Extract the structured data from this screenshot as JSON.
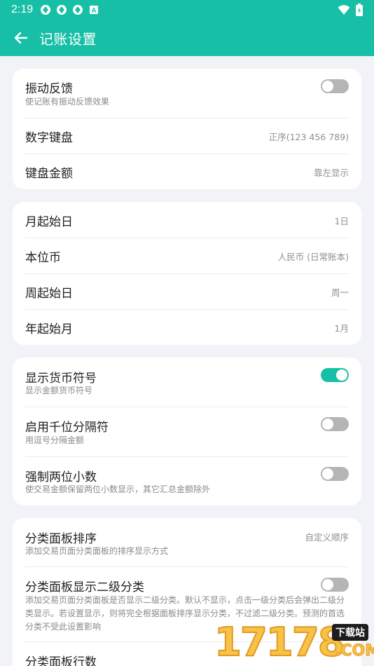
{
  "status_bar": {
    "time": "2:19",
    "icons": [
      "app-notification-icon",
      "app-notification-icon",
      "app-notification-icon",
      "a-badge-icon"
    ],
    "right_icons": [
      "wifi-icon",
      "battery-icon"
    ]
  },
  "header": {
    "title": "记账设置",
    "background": "#17bfa6"
  },
  "colors": {
    "accent": "#17bfa6",
    "toggle_off": "#b5b5b5"
  },
  "card1": {
    "vibration": {
      "title": "振动反馈",
      "subtitle": "使记账有振动反馈效果",
      "enabled": false
    },
    "keypad": {
      "title": "数字键盘",
      "value": "正序(123 456 789)"
    },
    "keypad_amount": {
      "title": "键盘金额",
      "value": "靠左显示"
    }
  },
  "card2": {
    "month_start": {
      "title": "月起始日",
      "value": "1日"
    },
    "base_currency": {
      "title": "本位币",
      "value": "人民币 (日常账本)"
    },
    "week_start": {
      "title": "周起始日",
      "value": "周一"
    },
    "year_start": {
      "title": "年起始月",
      "value": "1月"
    }
  },
  "card3": {
    "show_currency_symbol": {
      "title": "显示货币符号",
      "subtitle": "显示金额货币符号",
      "enabled": true
    },
    "thousand_separator": {
      "title": "启用千位分隔符",
      "subtitle": "用逗号分隔金额",
      "enabled": false
    },
    "two_decimals": {
      "title": "强制两位小数",
      "subtitle": "使交易金额保留两位小数显示，其它汇总金额除外",
      "enabled": false
    }
  },
  "card4": {
    "panel_order": {
      "title": "分类面板排序",
      "subtitle": "添加交易页面分类面板的排序显示方式",
      "value": "自定义顺序"
    },
    "panel_subcategory": {
      "title": "分类面板显示二级分类",
      "subtitle": "添加交易页面分类面板是否显示二级分类。默认不显示，点击一级分类后会弹出二级分类显示。若设置显示，则将完全根据面板排序显示分类，不过滤二级分类。预测的首选分类不受此设置影响",
      "enabled": false
    },
    "panel_rows": {
      "title": "分类面板行数"
    }
  },
  "watermark": {
    "digits": "17178",
    "badge": "下载站",
    "suffix": ".COM"
  }
}
